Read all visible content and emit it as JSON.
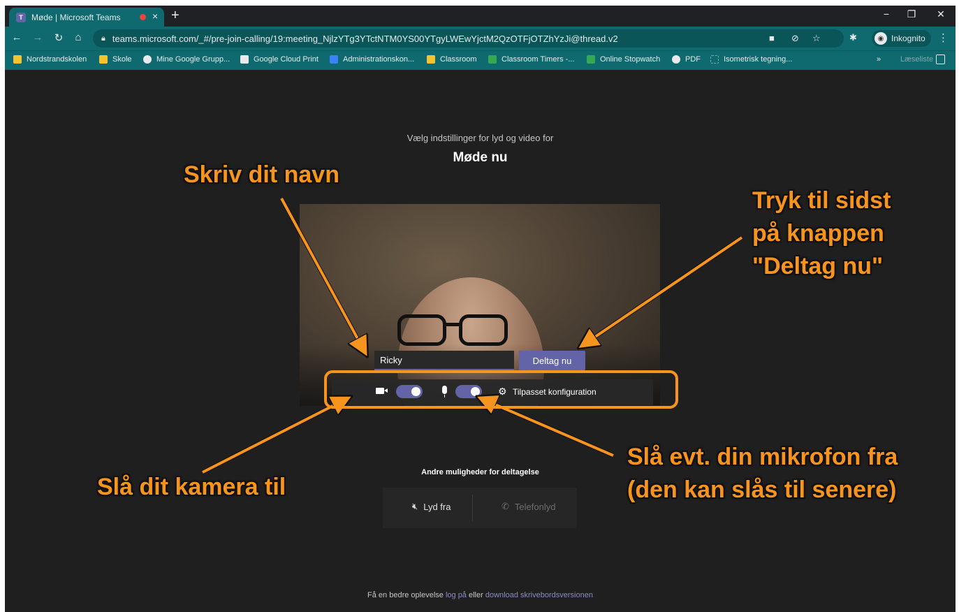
{
  "browser": {
    "tab_title": "Møde | Microsoft Teams",
    "tab_close": "×",
    "new_tab": "+",
    "url": "teams.microsoft.com/_#/pre-join-calling/19:meeting_NjlzYTg3YTctNTM0YS00YTgyLWEwYjctM2QzOTFjOTZhYzJi@thread.v2",
    "profile_label": "Inkognito",
    "bookmarks": [
      {
        "label": "Nordstrandskolen",
        "color": "#f4c430"
      },
      {
        "label": "Skole",
        "color": "#f4c430"
      },
      {
        "label": "Mine Google Grupp...",
        "color": "#e8eaed"
      },
      {
        "label": "Google Cloud Print",
        "color": "#e8eaed"
      },
      {
        "label": "Administrationskon...",
        "color": "#3b82f6"
      },
      {
        "label": "Classroom",
        "color": "#f4c430"
      },
      {
        "label": "Classroom Timers -...",
        "color": "#34a853"
      },
      {
        "label": "Online Stopwatch",
        "color": "#34a853"
      },
      {
        "label": "PDF",
        "color": "#e8eaed"
      },
      {
        "label": "Isometrisk tegning...",
        "color": "#0e6a6f"
      }
    ],
    "bookmarks_more": "»",
    "reading_list": "Læseliste"
  },
  "prejoin": {
    "subtitle": "Vælg indstillinger for lyd og video for",
    "title": "Møde nu",
    "name_value": "Ricky",
    "join_label": "Deltag nu",
    "camera_on": true,
    "mic_on": true,
    "device_settings_label": "Tilpasset konfiguration"
  },
  "other_options": {
    "title": "Andre muligheder for deltagelse",
    "audio_off_label": "Lyd fra",
    "phone_audio_label": "Telefonlyd"
  },
  "footer": {
    "prefix": "Få en bedre oplevelse",
    "login_link": "log på",
    "middle": "eller",
    "download_link": "download skrivebordsversionen"
  },
  "annotations": {
    "write_name": "Skriv dit navn",
    "join_last_line1": "Tryk til sidst",
    "join_last_line2": "på knappen",
    "join_last_line3": "\"Deltag nu\"",
    "camera_on": "Slå dit kamera til",
    "mic_off_line1": "Slå evt. din mikrofon fra",
    "mic_off_line2": "(den kan slås til senere)",
    "accent_color": "#f7941d"
  }
}
